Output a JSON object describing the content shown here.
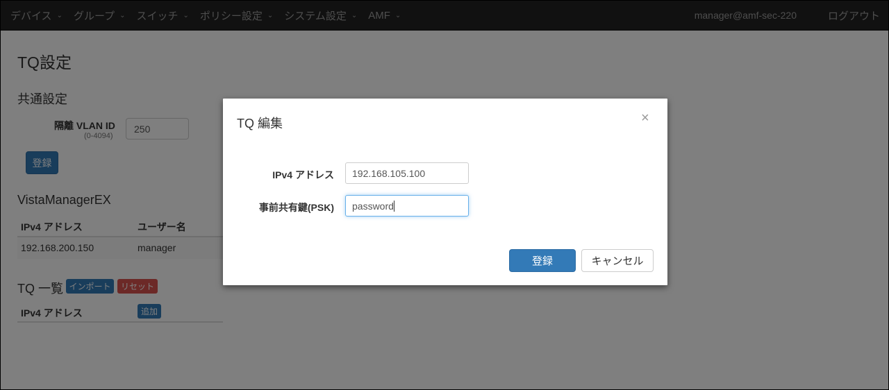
{
  "nav": {
    "items": [
      {
        "label": "デバイス"
      },
      {
        "label": "グループ"
      },
      {
        "label": "スイッチ"
      },
      {
        "label": "ポリシー設定"
      },
      {
        "label": "システム設定"
      },
      {
        "label": "AMF"
      }
    ],
    "user": "manager@amf-sec-220",
    "logout": "ログアウト"
  },
  "page": {
    "title": "TQ設定",
    "common": {
      "title": "共通設定",
      "vlan_label": "隔離 VLAN ID",
      "vlan_hint": "(0-4094)",
      "vlan_value": "250",
      "register_button": "登録"
    },
    "vista": {
      "title": "VistaManagerEX",
      "columns": [
        "IPv4 アドレス",
        "ユーザー名"
      ],
      "rows": [
        [
          "192.168.200.150",
          "manager"
        ]
      ]
    },
    "tq_list": {
      "title": "TQ 一覧",
      "import_button": "インポート",
      "reset_button": "リセット",
      "column": "IPv4 アドレス",
      "add_button": "追加"
    }
  },
  "modal": {
    "title": "TQ 編集",
    "close": "×",
    "ip_label": "IPv4 アドレス",
    "ip_value": "192.168.105.100",
    "psk_label": "事前共有鍵(PSK)",
    "psk_value": "password",
    "register_button": "登録",
    "cancel_button": "キャンセル"
  },
  "colors": {
    "navbar": "#222222",
    "primary": "#337ab7",
    "danger": "#d9534f"
  }
}
